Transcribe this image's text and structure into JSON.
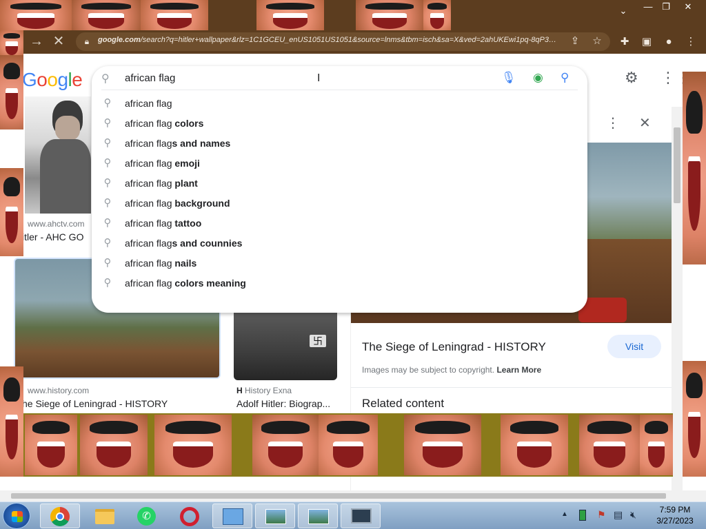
{
  "browser": {
    "url_domain": "google.com",
    "url_rest": "/search?q=hitler+wallpaper&rlz=1C1GCEU_enUS1051US1051&source=lnms&tbm=isch&sa=X&ved=2ahUKEwi1pq-8qP39AhXB..."
  },
  "google": {
    "logo_text": "Google",
    "query": "african flag"
  },
  "suggestions": [
    {
      "prefix": "african flag",
      "suffix": ""
    },
    {
      "prefix": "african flag",
      "suffix": " colors"
    },
    {
      "prefix": "african flag",
      "suffix": "s and names"
    },
    {
      "prefix": "african flag",
      "suffix": " emoji"
    },
    {
      "prefix": "african flag",
      "suffix": " plant"
    },
    {
      "prefix": "african flag",
      "suffix": " background"
    },
    {
      "prefix": "african flag",
      "suffix": " tattoo"
    },
    {
      "prefix": "african flag",
      "suffix": "s and counnies"
    },
    {
      "prefix": "african flag",
      "suffix": " nails"
    },
    {
      "prefix": "african flag",
      "suffix": " colors meaning"
    }
  ],
  "results": {
    "r1_site": "www.ahctv.com",
    "r1_title": "itler - AHC GO",
    "r2_site": "www.history.com",
    "r2_title": "he Siege of Leningrad - HISTORY",
    "r3_site": "History Exna",
    "r3_title": "Adolf Hitler: Biograp..."
  },
  "panel": {
    "title": "The Siege of Leningrad - HISTORY",
    "visit_label": "Visit",
    "copyright": "Images may be subject to copyright.",
    "learn_more": "Learn More",
    "related": "Related content"
  },
  "taskbar": {
    "time": "7:59 PM",
    "date": "3/27/2023"
  },
  "colors": {
    "frame": "#5c3d1f",
    "google_blue": "#4285f4",
    "google_red": "#ea4335",
    "google_yellow": "#fbbc05",
    "google_green": "#34a853",
    "visit_bg": "#e8f0fe"
  }
}
